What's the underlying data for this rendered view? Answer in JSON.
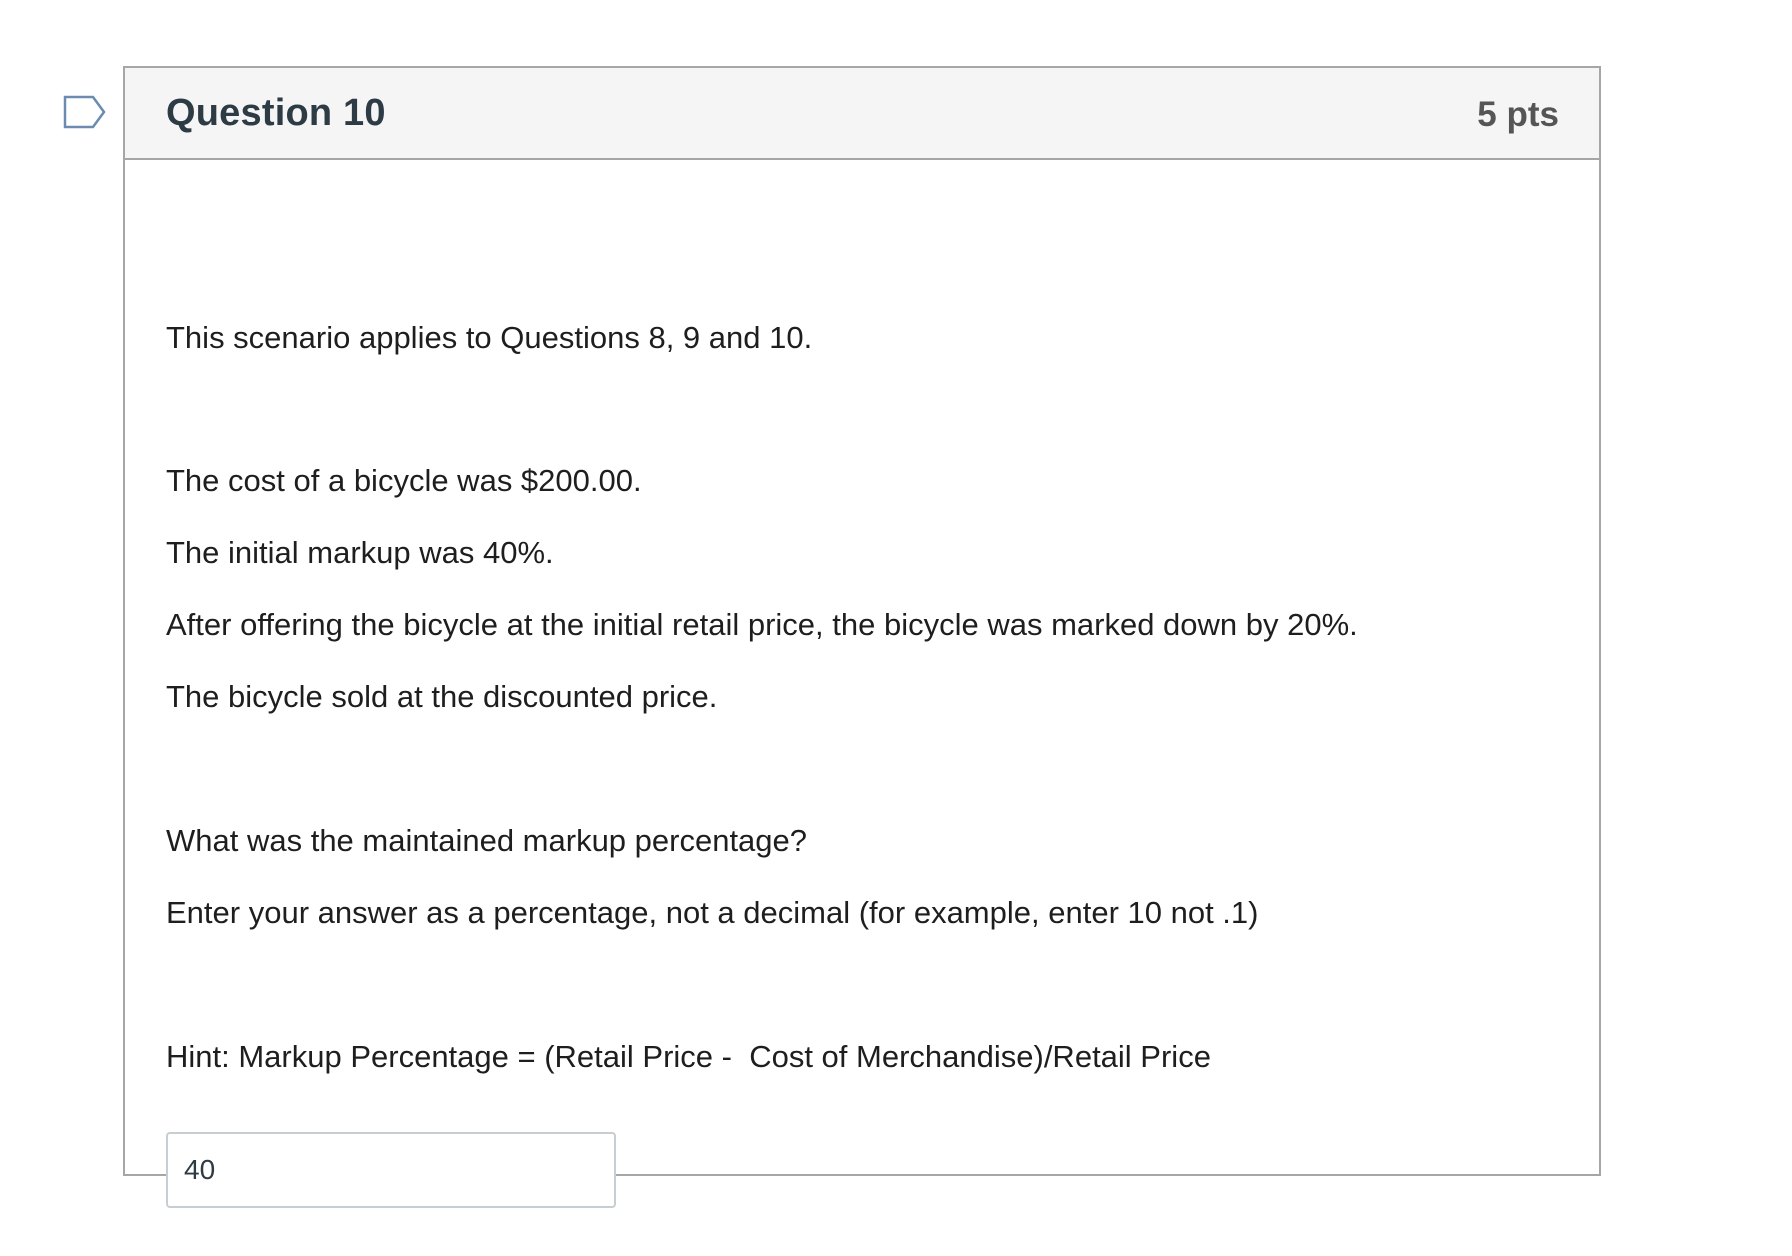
{
  "question": {
    "title": "Question 10",
    "points": "5 pts",
    "flag_icon": "bookmark-flag-icon"
  },
  "body": {
    "scenario": "This scenario applies to Questions 8, 9 and 10.",
    "cost_line": "The cost of a bicycle was $200.00.",
    "markup_line": "The initial markup was 40%.",
    "markdown_line": "After offering the bicycle at the initial retail price, the bicycle was marked down by 20%.",
    "sold_line": "The bicycle sold at the discounted price.",
    "question_line": "What was the maintained markup percentage?",
    "instruction_line": "Enter your answer as a percentage, not a decimal (for example, enter 10 not .1)",
    "hint_line": "Hint: Markup Percentage = (Retail Price -  Cost of Merchandise)/Retail Price"
  },
  "answer": {
    "value": "40"
  },
  "colors": {
    "header_bg": "#f5f5f5",
    "border": "#a6a6a6",
    "flag_stroke": "#6b8bb0"
  }
}
